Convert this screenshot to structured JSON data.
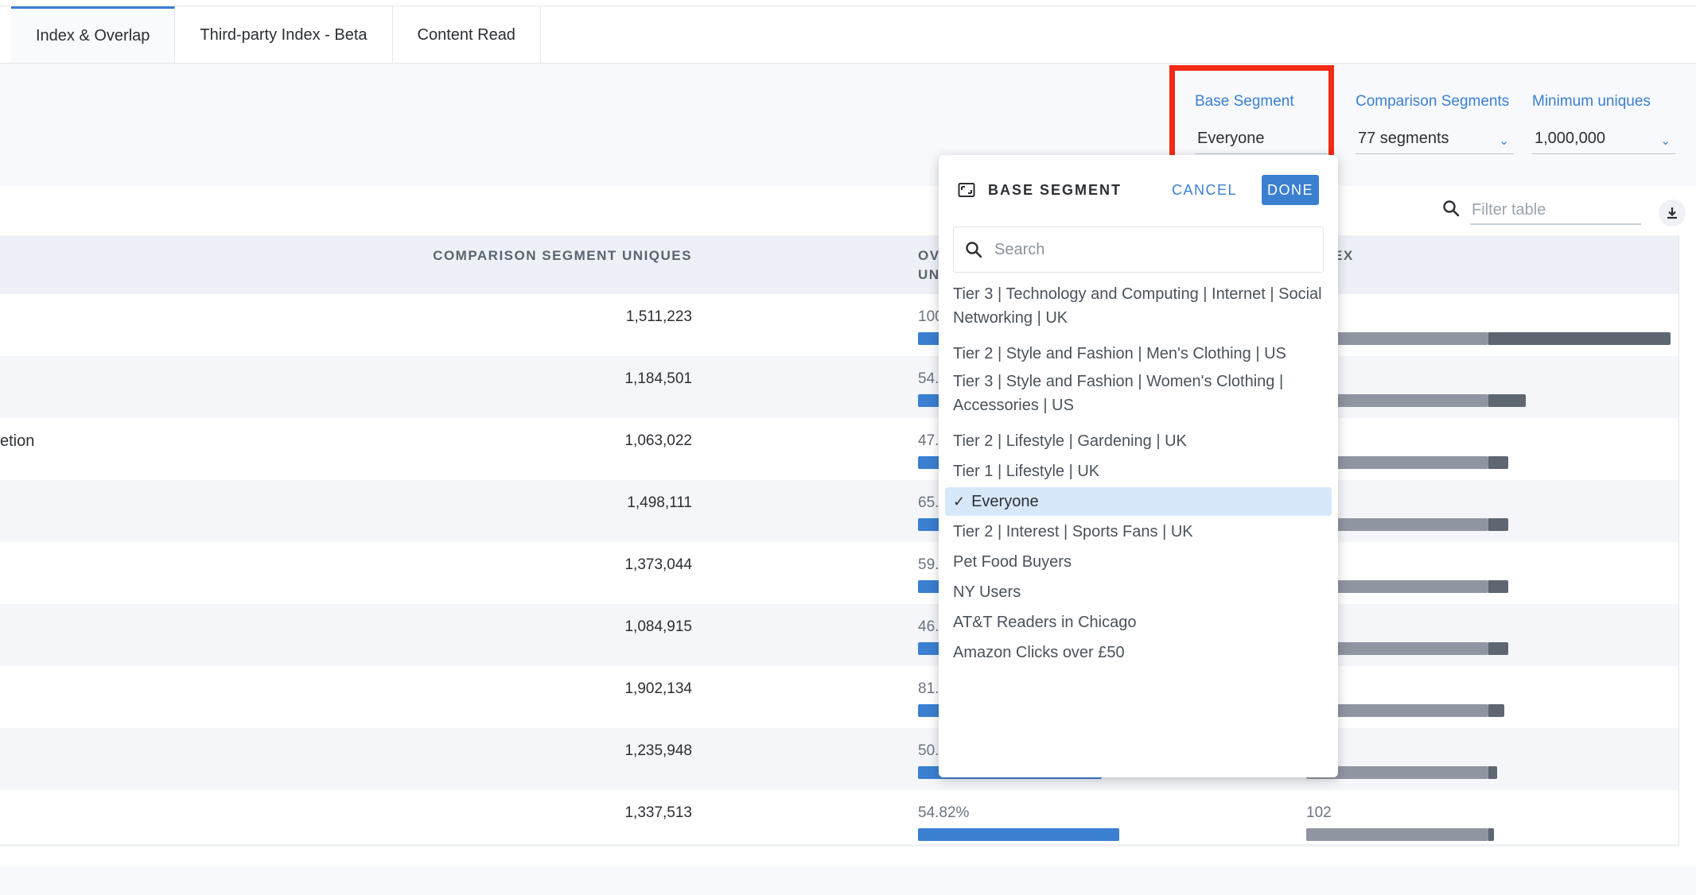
{
  "tabs": [
    {
      "label": "Index & Overlap",
      "active": true
    },
    {
      "label": "Third-party Index - Beta",
      "active": false
    },
    {
      "label": "Content Read",
      "active": false
    }
  ],
  "controls": {
    "base_segment": {
      "label": "Base Segment",
      "value": "Everyone"
    },
    "comparison_segments": {
      "label": "Comparison Segments",
      "value": "77 segments"
    },
    "minimum_uniques": {
      "label": "Minimum uniques",
      "value": "1,000,000"
    }
  },
  "filter": {
    "placeholder": "Filter table"
  },
  "table": {
    "headers": {
      "comparison_uniques": "COMPARISON SEGMENT UNIQUES",
      "overlap_line1": "OV",
      "overlap_line2": "UN",
      "index": "EX"
    },
    "rows": [
      {
        "name": "",
        "uniques": "1,511,223",
        "overlap": "100",
        "overlap_frac": 0.0,
        "index": "",
        "index_frac": 1.0
      },
      {
        "name": "",
        "uniques": "1,184,501",
        "overlap": "54.",
        "overlap_frac": 0.0,
        "index": "",
        "index_frac": 0.6
      },
      {
        "name": "etion",
        "uniques": "1,063,022",
        "overlap": "47.",
        "overlap_frac": 0.0,
        "index": "",
        "index_frac": 0.55
      },
      {
        "name": "",
        "uniques": "1,498,111",
        "overlap": "65.",
        "overlap_frac": 0.0,
        "index": "",
        "index_frac": 0.55
      },
      {
        "name": "",
        "uniques": "1,373,044",
        "overlap": "59.",
        "overlap_frac": 0.0,
        "index": "",
        "index_frac": 0.55
      },
      {
        "name": "",
        "uniques": "1,084,915",
        "overlap": "46.",
        "overlap_frac": 0.0,
        "index": "",
        "index_frac": 0.55
      },
      {
        "name": "",
        "uniques": "1,902,134",
        "overlap": "81.",
        "overlap_frac": 0.0,
        "index": "",
        "index_frac": 0.54
      },
      {
        "name": "",
        "uniques": "1,235,948",
        "overlap": "50.",
        "overlap_frac": 0.5,
        "index": "",
        "index_frac": 0.52
      },
      {
        "name": "",
        "uniques": "1,337,513",
        "overlap": "54.82%",
        "overlap_frac": 0.5482,
        "index": "102",
        "index_frac": 0.51
      }
    ]
  },
  "dropdown": {
    "title": "BASE SEGMENT",
    "cancel_label": "CANCEL",
    "done_label": "DONE",
    "search_placeholder": "Search",
    "items": [
      {
        "label": "Tier 3 | Technology and Computing | Internet | Social Networking | UK",
        "selected": false
      },
      {
        "label": "Tier 2 | Style and Fashion | Men's Clothing | US",
        "selected": false
      },
      {
        "label": "Tier 3 | Style and Fashion | Women's Clothing | Accessories | US",
        "selected": false
      },
      {
        "label": "Tier 2 | Lifestyle | Gardening | UK",
        "selected": false
      },
      {
        "label": "Tier 1 | Lifestyle | UK",
        "selected": false
      },
      {
        "label": "Everyone",
        "selected": true
      },
      {
        "label": "Tier 2 | Interest | Sports Fans | UK",
        "selected": false
      },
      {
        "label": "Pet Food Buyers",
        "selected": false
      },
      {
        "label": "NY Users",
        "selected": false
      },
      {
        "label": "AT&T Readers in Chicago",
        "selected": false
      },
      {
        "label": "Amazon Clicks over £50",
        "selected": false
      }
    ],
    "check_glyph": "✓"
  },
  "colors": {
    "accent": "#3b7fd1",
    "highlight": "#f02b16",
    "bar_light": "#8f96a1",
    "bar_dark": "#5e6672"
  }
}
